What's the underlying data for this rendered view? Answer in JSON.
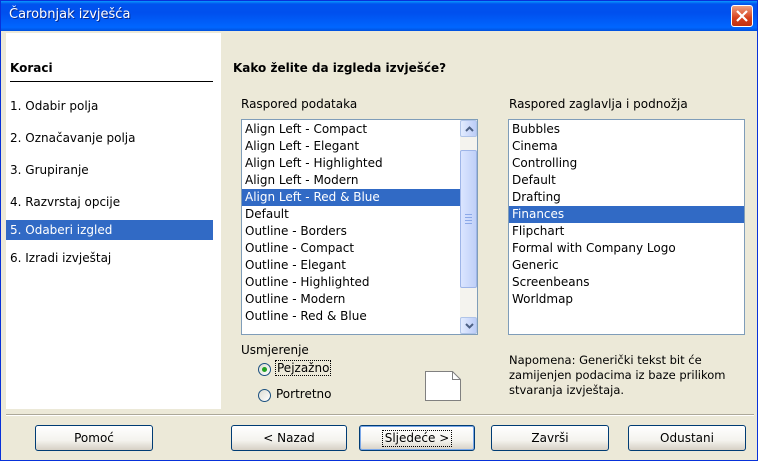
{
  "window": {
    "title": "Čarobnjak izvješća"
  },
  "steps": {
    "header": "Koraci",
    "items": [
      {
        "label": "1.  Odabir polja"
      },
      {
        "label": "2.  Označavanje polja"
      },
      {
        "label": "3.  Grupiranje"
      },
      {
        "label": "4.  Razvrstaj opcije"
      },
      {
        "label": "5.  Odaberi izgled",
        "active": true
      },
      {
        "label": "6.  Izradi izvještaj"
      }
    ]
  },
  "main": {
    "question": "Kako želite da izgleda izvješće?",
    "data_layout": {
      "label": "Raspored podataka",
      "items": [
        "Align Left - Compact",
        "Align Left - Elegant",
        "Align Left - Highlighted",
        "Align Left - Modern",
        "Align Left - Red & Blue",
        "Default",
        "Outline - Borders",
        "Outline - Compact",
        "Outline - Elegant",
        "Outline - Highlighted",
        "Outline - Modern",
        "Outline - Red & Blue"
      ],
      "selected": "Align Left - Red & Blue"
    },
    "header_footer_layout": {
      "label": "Raspored zaglavlja i podnožja",
      "items": [
        "Bubbles",
        "Cinema",
        "Controlling",
        "Default",
        "Drafting",
        "Finances",
        "Flipchart",
        "Formal with Company Logo",
        "Generic",
        "Screenbeans",
        "Worldmap"
      ],
      "selected": "Finances"
    },
    "orientation": {
      "label": "Usmjerenje",
      "landscape": "Pejzažno",
      "portrait": "Portretno",
      "selected": "landscape"
    },
    "note": "Napomena: Generički tekst bit će zamijenjen podacima iz baze prilikom stvaranja izvještaja."
  },
  "buttons": {
    "help": "Pomoć",
    "back": "< Nazad",
    "next": "Sljedeće >",
    "finish": "Završi",
    "cancel": "Odustani"
  },
  "colors": {
    "selection": "#316ac5",
    "titlebar": "#0054e3",
    "dialog_bg": "#ece9d8"
  }
}
